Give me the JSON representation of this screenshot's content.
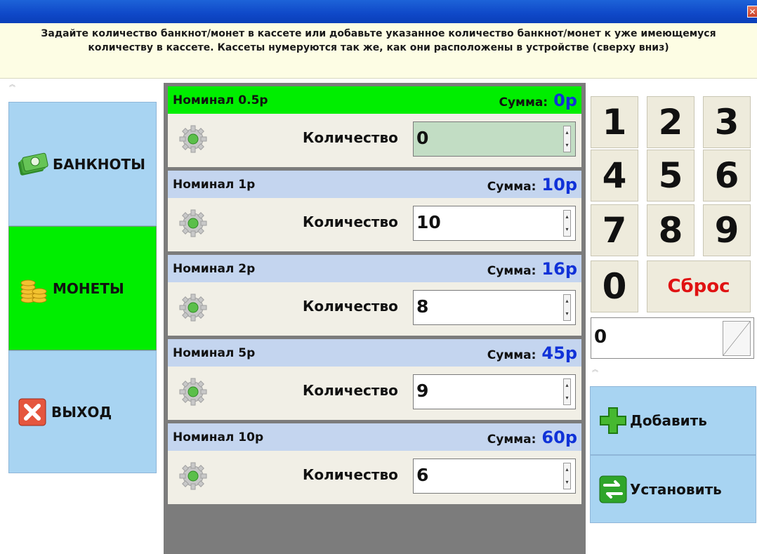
{
  "window": {
    "close_glyph": "✕"
  },
  "info": {
    "text": "Задайте количество банкнот/монет в кассете или добавьте указанное количество банкнот/монет к уже имеющемуся количеству в кассете. Кассеты нумеруются так же, как они расположены в устройстве (сверху вниз)"
  },
  "nav": {
    "banknotes": {
      "label": "БАНКНОТЫ",
      "icon": "banknotes-icon"
    },
    "coins": {
      "label": "МОНЕТЫ",
      "icon": "coins-icon"
    },
    "exit": {
      "label": "ВЫХОД",
      "icon": "close-icon"
    }
  },
  "cassettes": [
    {
      "name": "Номинал 0.5р",
      "sum_label": "Сумма:",
      "sum": "0р",
      "qty_label": "Количество",
      "qty": "0"
    },
    {
      "name": "Номинал 1р",
      "sum_label": "Сумма:",
      "sum": "10р",
      "qty_label": "Количество",
      "qty": "10"
    },
    {
      "name": "Номинал 2р",
      "sum_label": "Сумма:",
      "sum": "16р",
      "qty_label": "Количество",
      "qty": "8"
    },
    {
      "name": "Номинал 5р",
      "sum_label": "Сумма:",
      "sum": "45р",
      "qty_label": "Количество",
      "qty": "9"
    },
    {
      "name": "Номинал 10р",
      "sum_label": "Сумма:",
      "sum": "60р",
      "qty_label": "Количество",
      "qty": "6"
    }
  ],
  "keypad": {
    "keys": [
      "1",
      "2",
      "3",
      "4",
      "5",
      "6",
      "7",
      "8",
      "9",
      "0"
    ],
    "reset": "Сброс"
  },
  "entry": {
    "value": "0"
  },
  "actions": {
    "add": {
      "label": "Добавить",
      "icon": "plus-icon"
    },
    "set": {
      "label": "Установить",
      "icon": "arrows-swap-icon"
    }
  },
  "colors": {
    "active_green": "#00ee00",
    "nav_blue": "#a8d4f2",
    "header_blue": "#c4d5ef",
    "sum_blue": "#1032d8",
    "reset_red": "#e01212"
  }
}
